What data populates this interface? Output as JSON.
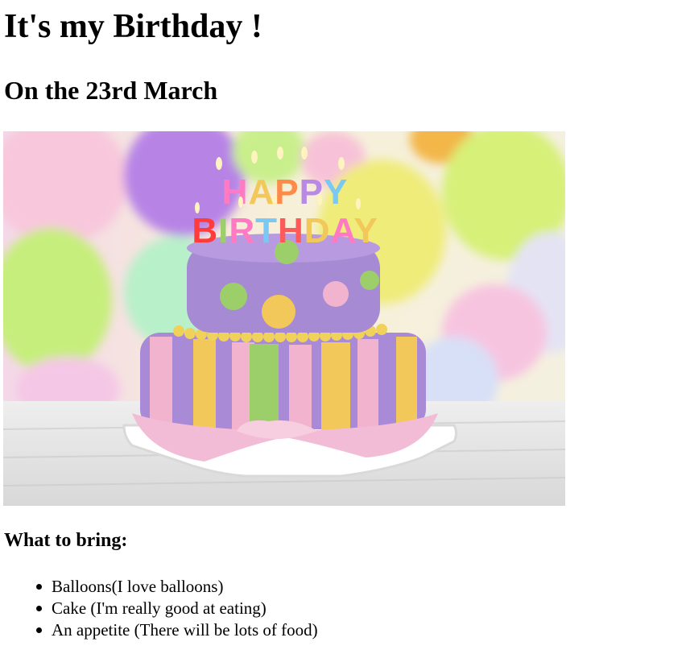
{
  "page": {
    "heading": "It's my Birthday !",
    "subheading": "On the 23rd March",
    "photo": {
      "cake_topper_line1": "HAPPY",
      "cake_topper_line2": "BIRTHDAY"
    },
    "list_heading": "What to bring:",
    "items": [
      "Balloons(I love balloons)",
      "Cake (I'm really good at eating)",
      "An appetite (There will be lots of food)"
    ]
  },
  "colors": {
    "text": "#000000",
    "background": "#ffffff",
    "cake_purple": "#a98ad6",
    "cake_pink": "#f2b3cf",
    "cake_yellow": "#f2c85a",
    "cake_green": "#9ccf6a"
  }
}
